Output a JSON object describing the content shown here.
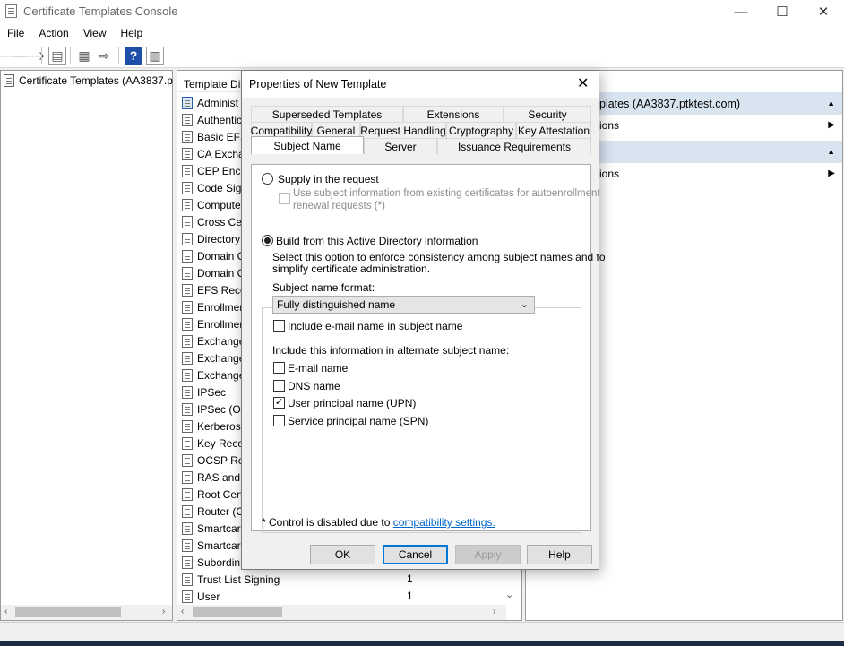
{
  "window": {
    "title": "Certificate Templates Console",
    "minimize": "—",
    "maximize": "☐",
    "close": "✕"
  },
  "menu": [
    "File",
    "Action",
    "View",
    "Help"
  ],
  "tree": {
    "root_label": "Certificate Templates (AA3837.p"
  },
  "list": {
    "col_display_name": "Template Dis",
    "rows": [
      {
        "name": "Administ",
        "version": ""
      },
      {
        "name": "Authentic",
        "version": ""
      },
      {
        "name": "Basic EFS",
        "version": ""
      },
      {
        "name": "CA Excha",
        "version": ""
      },
      {
        "name": "CEP Encry",
        "version": ""
      },
      {
        "name": "Code Sign",
        "version": ""
      },
      {
        "name": "Compute",
        "version": ""
      },
      {
        "name": "Cross Cer",
        "version": ""
      },
      {
        "name": "Directory",
        "version": ""
      },
      {
        "name": "Domain C",
        "version": ""
      },
      {
        "name": "Domain C",
        "version": ""
      },
      {
        "name": "EFS Reco",
        "version": ""
      },
      {
        "name": "Enrollmer",
        "version": ""
      },
      {
        "name": "Enrollmer",
        "version": ""
      },
      {
        "name": "Exchange",
        "version": ""
      },
      {
        "name": "Exchange",
        "version": ""
      },
      {
        "name": "Exchange",
        "version": ""
      },
      {
        "name": "IPSec",
        "version": ""
      },
      {
        "name": "IPSec (Of",
        "version": ""
      },
      {
        "name": "Kerberos",
        "version": ""
      },
      {
        "name": "Key Reco",
        "version": ""
      },
      {
        "name": "OCSP Res",
        "version": ""
      },
      {
        "name": "RAS and I",
        "version": ""
      },
      {
        "name": "Root Cert",
        "version": ""
      },
      {
        "name": "Router (O",
        "version": ""
      },
      {
        "name": "Smartcar",
        "version": ""
      },
      {
        "name": "Smartcar",
        "version": ""
      },
      {
        "name": "Subordin",
        "version": ""
      },
      {
        "name": "Trust List Signing",
        "version": "1"
      },
      {
        "name": "User",
        "version": "1"
      }
    ]
  },
  "actions": {
    "section1_title": "plates (AA3837.ptktest.com)",
    "section1_item": "ions",
    "section2_item": "ions"
  },
  "dialog": {
    "title": "Properties of New Template",
    "tabs_row1": [
      "Superseded Templates",
      "Extensions",
      "Security"
    ],
    "tabs_row2": [
      "Compatibility",
      "General",
      "Request Handling",
      "Cryptography",
      "Key Attestation"
    ],
    "tabs_row3": [
      "Subject Name",
      "Server",
      "Issuance Requirements"
    ],
    "supply_label": "Supply in the request",
    "use_subject_info": "Use subject information from existing certificates for autoenrollment",
    "use_subject_info2": "renewal requests (*)",
    "build_label": "Build from this Active Directory information",
    "build_desc1": "Select this option to enforce consistency among subject names and to",
    "build_desc2": "simplify certificate administration.",
    "format_label": "Subject name format:",
    "format_value": "Fully distinguished name",
    "include_email": "Include e-mail name in subject name",
    "alt_label": "Include this information in alternate subject name:",
    "alt_options": [
      {
        "label": "E-mail name",
        "checked": ""
      },
      {
        "label": "DNS name",
        "checked": ""
      },
      {
        "label": "User principal name (UPN)",
        "checked": "✓"
      },
      {
        "label": "Service principal name (SPN)",
        "checked": ""
      }
    ],
    "footnote": "* Control is disabled due to",
    "footnote_link": "compatibility settings.",
    "buttons": {
      "ok": "OK",
      "cancel": "Cancel",
      "apply": "Apply",
      "help": "Help"
    }
  }
}
